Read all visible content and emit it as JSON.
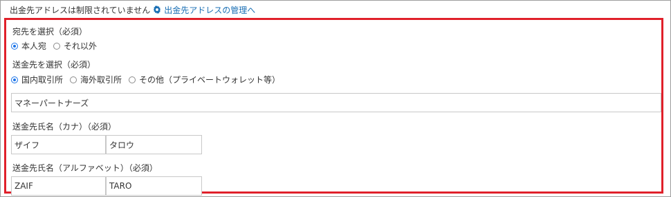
{
  "topbar": {
    "notice": "出金先アドレスは制限されていません",
    "manage_link": "出金先アドレスの管理へ",
    "link_icon": "gear-icon",
    "link_color": "#1a6fb4"
  },
  "form": {
    "accent_color": "#e0202a",
    "recipient": {
      "label": "宛先を選択（必須）",
      "options": [
        "本人宛",
        "それ以外"
      ],
      "selected": "本人宛"
    },
    "destination": {
      "label": "送金先を選択（必須）",
      "options": [
        "国内取引所",
        "海外取引所",
        "その他（プライベートウォレット等）"
      ],
      "selected": "国内取引所"
    },
    "exchange_name": {
      "value": "マネーパートナーズ"
    },
    "kana_name": {
      "label": "送金先氏名（カナ）（必須）",
      "last_name": "ザイフ",
      "first_name": "タロウ"
    },
    "alpha_name": {
      "label": "送金先氏名（アルファベット）（必須）",
      "last_name": "ZAIF",
      "first_name": "TARO"
    }
  }
}
